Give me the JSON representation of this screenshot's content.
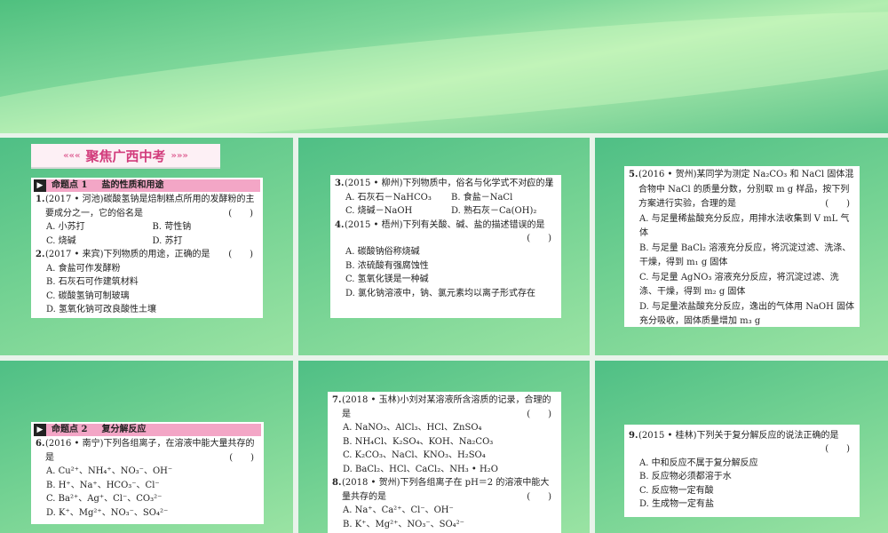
{
  "header": {
    "title": "聚焦广西中考",
    "left_deco": "«««",
    "right_deco": "»»»"
  },
  "topic1": {
    "label": "命题点 1",
    "name": "盐的性质和用途"
  },
  "topic2": {
    "label": "命题点 2",
    "name": "复分解反应"
  },
  "bracket": "(　　)",
  "questions": [
    {
      "num": "1.",
      "stem": "(2017 • 河池)碳酸氢钠是焙制糕点所用的发酵粉的主要成分之一，它的俗名是",
      "options": [
        "A. 小苏打",
        "B. 苛性钠",
        "C. 烧碱",
        "D. 苏打"
      ]
    },
    {
      "num": "2.",
      "stem": "(2017 • 来宾)下列物质的用途，正确的是",
      "options": [
        "A. 食盐可作发酵粉",
        "B. 石灰石可作建筑材料",
        "C. 碳酸氢钠可制玻璃",
        "D. 氢氧化钠可改良酸性土壤"
      ]
    },
    {
      "num": "3.",
      "stem": "(2015 • 柳州)下列物质中，俗名与化学式不对应的是",
      "options": [
        "A. 石灰石－NaHCO₃",
        "B. 食盐－NaCl",
        "C. 烧碱－NaOH",
        "D. 熟石灰－Ca(OH)₂"
      ]
    },
    {
      "num": "4.",
      "stem": "(2015 • 梧州)下列有关酸、碱、盐的描述错误的是",
      "options": [
        "A. 碳酸钠俗称烧碱",
        "B. 浓硫酸有强腐蚀性",
        "C. 氢氧化镁是一种碱",
        "D. 氯化钠溶液中，钠、氯元素均以离子形式存在"
      ]
    },
    {
      "num": "5.",
      "stem": "(2016 • 贺州)某同学为测定 Na₂CO₃ 和 NaCl 固体混合物中 NaCl 的质量分数，分别取 m g 样品，按下列方案进行实验，合理的是",
      "options": [
        "A. 与足量稀盐酸充分反应，用排水法收集到 V mL 气体",
        "B. 与足量 BaCl₂ 溶液充分反应，将沉淀过滤、洗涤、干燥，得到 m₁ g 固体",
        "C. 与足量 AgNO₃ 溶液充分反应，将沉淀过滤、洗涤、干燥，得到 m₂ g 固体",
        "D. 与足量浓盐酸充分反应，逸出的气体用 NaOH 固体充分吸收，固体质量增加 m₃ g"
      ]
    },
    {
      "num": "6.",
      "stem": "(2016 • 南宁)下列各组离子，在溶液中能大量共存的是",
      "options": [
        "A. Cu²⁺、NH₄⁺、NO₃⁻、OH⁻",
        "B. H⁺、Na⁺、HCO₃⁻、Cl⁻",
        "C. Ba²⁺、Ag⁺、Cl⁻、CO₃²⁻",
        "D. K⁺、Mg²⁺、NO₃⁻、SO₄²⁻"
      ]
    },
    {
      "num": "7.",
      "stem": "(2018 • 玉林)小刘对某溶液所含溶质的记录，合理的是",
      "options": [
        "A. NaNO₃、AlCl₃、HCl、ZnSO₄",
        "B. NH₄Cl、K₂SO₄、KOH、Na₂CO₃",
        "C. K₂CO₃、NaCl、KNO₃、H₂SO₄",
        "D. BaCl₂、HCl、CaCl₂、NH₃ • H₂O"
      ]
    },
    {
      "num": "8.",
      "stem": "(2018 • 贺州)下列各组离子在 pH＝2 的溶液中能大量共存的是",
      "options": [
        "A. Na⁺、Ca²⁺、Cl⁻、OH⁻",
        "B. K⁺、Mg²⁺、NO₃⁻、SO₄²⁻"
      ]
    },
    {
      "num": "9.",
      "stem": "(2015 • 桂林)下列关于复分解反应的说法正确的是",
      "options": [
        "A. 中和反应不属于复分解反应",
        "B. 反应物必须都溶于水",
        "C. 反应物一定有酸",
        "D. 生成物一定有盐"
      ]
    }
  ]
}
